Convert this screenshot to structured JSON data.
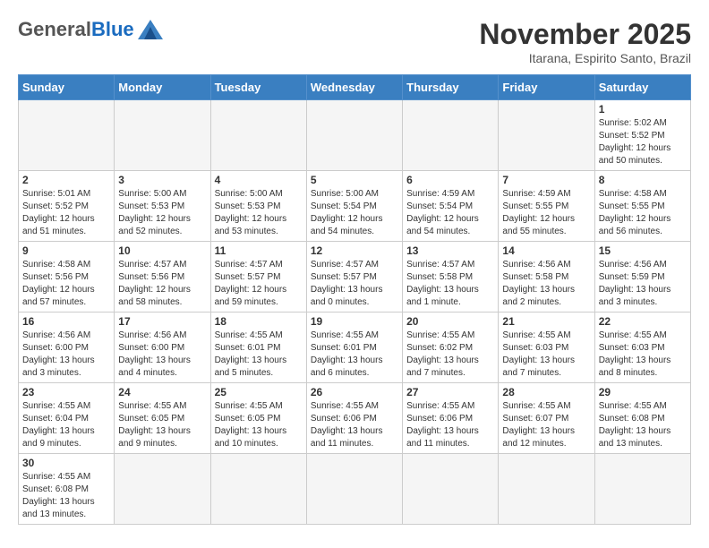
{
  "logo": {
    "general": "General",
    "blue": "Blue"
  },
  "title": "November 2025",
  "subtitle": "Itarana, Espirito Santo, Brazil",
  "days_of_week": [
    "Sunday",
    "Monday",
    "Tuesday",
    "Wednesday",
    "Thursday",
    "Friday",
    "Saturday"
  ],
  "weeks": [
    [
      {
        "day": "",
        "info": ""
      },
      {
        "day": "",
        "info": ""
      },
      {
        "day": "",
        "info": ""
      },
      {
        "day": "",
        "info": ""
      },
      {
        "day": "",
        "info": ""
      },
      {
        "day": "",
        "info": ""
      },
      {
        "day": "1",
        "info": "Sunrise: 5:02 AM\nSunset: 5:52 PM\nDaylight: 12 hours and 50 minutes."
      }
    ],
    [
      {
        "day": "2",
        "info": "Sunrise: 5:01 AM\nSunset: 5:52 PM\nDaylight: 12 hours and 51 minutes."
      },
      {
        "day": "3",
        "info": "Sunrise: 5:00 AM\nSunset: 5:53 PM\nDaylight: 12 hours and 52 minutes."
      },
      {
        "day": "4",
        "info": "Sunrise: 5:00 AM\nSunset: 5:53 PM\nDaylight: 12 hours and 53 minutes."
      },
      {
        "day": "5",
        "info": "Sunrise: 5:00 AM\nSunset: 5:54 PM\nDaylight: 12 hours and 54 minutes."
      },
      {
        "day": "6",
        "info": "Sunrise: 4:59 AM\nSunset: 5:54 PM\nDaylight: 12 hours and 54 minutes."
      },
      {
        "day": "7",
        "info": "Sunrise: 4:59 AM\nSunset: 5:55 PM\nDaylight: 12 hours and 55 minutes."
      },
      {
        "day": "8",
        "info": "Sunrise: 4:58 AM\nSunset: 5:55 PM\nDaylight: 12 hours and 56 minutes."
      }
    ],
    [
      {
        "day": "9",
        "info": "Sunrise: 4:58 AM\nSunset: 5:56 PM\nDaylight: 12 hours and 57 minutes."
      },
      {
        "day": "10",
        "info": "Sunrise: 4:57 AM\nSunset: 5:56 PM\nDaylight: 12 hours and 58 minutes."
      },
      {
        "day": "11",
        "info": "Sunrise: 4:57 AM\nSunset: 5:57 PM\nDaylight: 12 hours and 59 minutes."
      },
      {
        "day": "12",
        "info": "Sunrise: 4:57 AM\nSunset: 5:57 PM\nDaylight: 13 hours and 0 minutes."
      },
      {
        "day": "13",
        "info": "Sunrise: 4:57 AM\nSunset: 5:58 PM\nDaylight: 13 hours and 1 minute."
      },
      {
        "day": "14",
        "info": "Sunrise: 4:56 AM\nSunset: 5:58 PM\nDaylight: 13 hours and 2 minutes."
      },
      {
        "day": "15",
        "info": "Sunrise: 4:56 AM\nSunset: 5:59 PM\nDaylight: 13 hours and 3 minutes."
      }
    ],
    [
      {
        "day": "16",
        "info": "Sunrise: 4:56 AM\nSunset: 6:00 PM\nDaylight: 13 hours and 3 minutes."
      },
      {
        "day": "17",
        "info": "Sunrise: 4:56 AM\nSunset: 6:00 PM\nDaylight: 13 hours and 4 minutes."
      },
      {
        "day": "18",
        "info": "Sunrise: 4:55 AM\nSunset: 6:01 PM\nDaylight: 13 hours and 5 minutes."
      },
      {
        "day": "19",
        "info": "Sunrise: 4:55 AM\nSunset: 6:01 PM\nDaylight: 13 hours and 6 minutes."
      },
      {
        "day": "20",
        "info": "Sunrise: 4:55 AM\nSunset: 6:02 PM\nDaylight: 13 hours and 7 minutes."
      },
      {
        "day": "21",
        "info": "Sunrise: 4:55 AM\nSunset: 6:03 PM\nDaylight: 13 hours and 7 minutes."
      },
      {
        "day": "22",
        "info": "Sunrise: 4:55 AM\nSunset: 6:03 PM\nDaylight: 13 hours and 8 minutes."
      }
    ],
    [
      {
        "day": "23",
        "info": "Sunrise: 4:55 AM\nSunset: 6:04 PM\nDaylight: 13 hours and 9 minutes."
      },
      {
        "day": "24",
        "info": "Sunrise: 4:55 AM\nSunset: 6:05 PM\nDaylight: 13 hours and 9 minutes."
      },
      {
        "day": "25",
        "info": "Sunrise: 4:55 AM\nSunset: 6:05 PM\nDaylight: 13 hours and 10 minutes."
      },
      {
        "day": "26",
        "info": "Sunrise: 4:55 AM\nSunset: 6:06 PM\nDaylight: 13 hours and 11 minutes."
      },
      {
        "day": "27",
        "info": "Sunrise: 4:55 AM\nSunset: 6:06 PM\nDaylight: 13 hours and 11 minutes."
      },
      {
        "day": "28",
        "info": "Sunrise: 4:55 AM\nSunset: 6:07 PM\nDaylight: 13 hours and 12 minutes."
      },
      {
        "day": "29",
        "info": "Sunrise: 4:55 AM\nSunset: 6:08 PM\nDaylight: 13 hours and 13 minutes."
      }
    ],
    [
      {
        "day": "30",
        "info": "Sunrise: 4:55 AM\nSunset: 6:08 PM\nDaylight: 13 hours and 13 minutes."
      },
      {
        "day": "",
        "info": ""
      },
      {
        "day": "",
        "info": ""
      },
      {
        "day": "",
        "info": ""
      },
      {
        "day": "",
        "info": ""
      },
      {
        "day": "",
        "info": ""
      },
      {
        "day": "",
        "info": ""
      }
    ]
  ]
}
